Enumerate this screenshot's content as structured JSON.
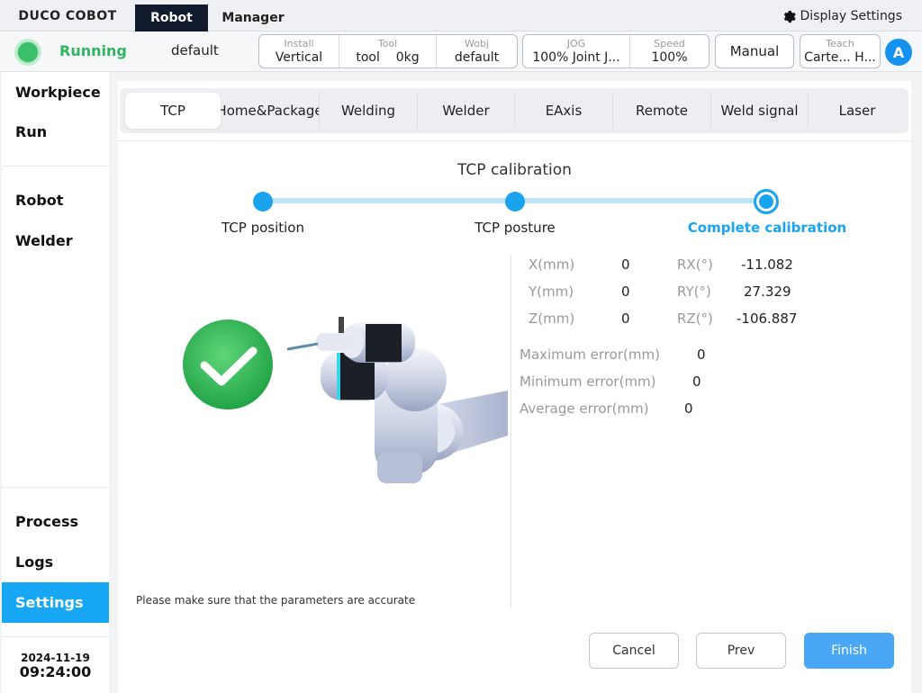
{
  "app": {
    "brand": "DUCO COBOT",
    "top_tabs": [
      {
        "label": "Robot",
        "active": true
      },
      {
        "label": "Manager",
        "active": false
      }
    ],
    "display_settings": "Display Settings",
    "accent_color": "#18a7f5"
  },
  "status": {
    "state": "Running",
    "program": "default",
    "install": {
      "label": "Install",
      "value": "Vertical"
    },
    "tool": {
      "label": "Tool",
      "name": "tool",
      "weight": "0kg"
    },
    "wobj": {
      "label": "Wobj",
      "value": "default"
    },
    "jog": {
      "label": "JOG",
      "value": "100% Joint J..."
    },
    "speed": {
      "label": "Speed",
      "value": "100%"
    },
    "mode": "Manual",
    "teach": {
      "label": "Teach",
      "value": "Carte... H..."
    },
    "user_initial": "A"
  },
  "sidebar": {
    "items": [
      {
        "label": "Workpiece"
      },
      {
        "label": "Run"
      },
      {
        "label": "Robot"
      },
      {
        "label": "Welder"
      },
      {
        "label": "Process"
      },
      {
        "label": "Logs"
      },
      {
        "label": "Settings",
        "active": true
      }
    ],
    "date": "2024-11-19",
    "time": "09:24:00"
  },
  "subtabs": [
    {
      "label": "TCP",
      "active": true
    },
    {
      "label": "Home&Package"
    },
    {
      "label": "Welding"
    },
    {
      "label": "Welder"
    },
    {
      "label": "EAxis"
    },
    {
      "label": "Remote"
    },
    {
      "label": "Weld signal"
    },
    {
      "label": "Laser"
    }
  ],
  "calibration": {
    "title": "TCP calibration",
    "steps": [
      {
        "label": "TCP position"
      },
      {
        "label": "TCP posture"
      },
      {
        "label": "Complete calibration",
        "current": true
      }
    ],
    "position": [
      {
        "label": "X(mm)",
        "value": "0"
      },
      {
        "label": "Y(mm)",
        "value": "0"
      },
      {
        "label": "Z(mm)",
        "value": "0"
      }
    ],
    "rotation": [
      {
        "label": "RX(°)",
        "value": "-11.082"
      },
      {
        "label": "RY(°)",
        "value": "27.329"
      },
      {
        "label": "RZ(°)",
        "value": "-106.887"
      }
    ],
    "errors": [
      {
        "label": "Maximum error(mm)",
        "value": "0"
      },
      {
        "label": "Minimum error(mm)",
        "value": "0"
      },
      {
        "label": "Average error(mm)",
        "value": "0"
      }
    ],
    "note": "Please make sure that the parameters are accurate"
  },
  "buttons": {
    "cancel": "Cancel",
    "prev": "Prev",
    "finish": "Finish"
  }
}
